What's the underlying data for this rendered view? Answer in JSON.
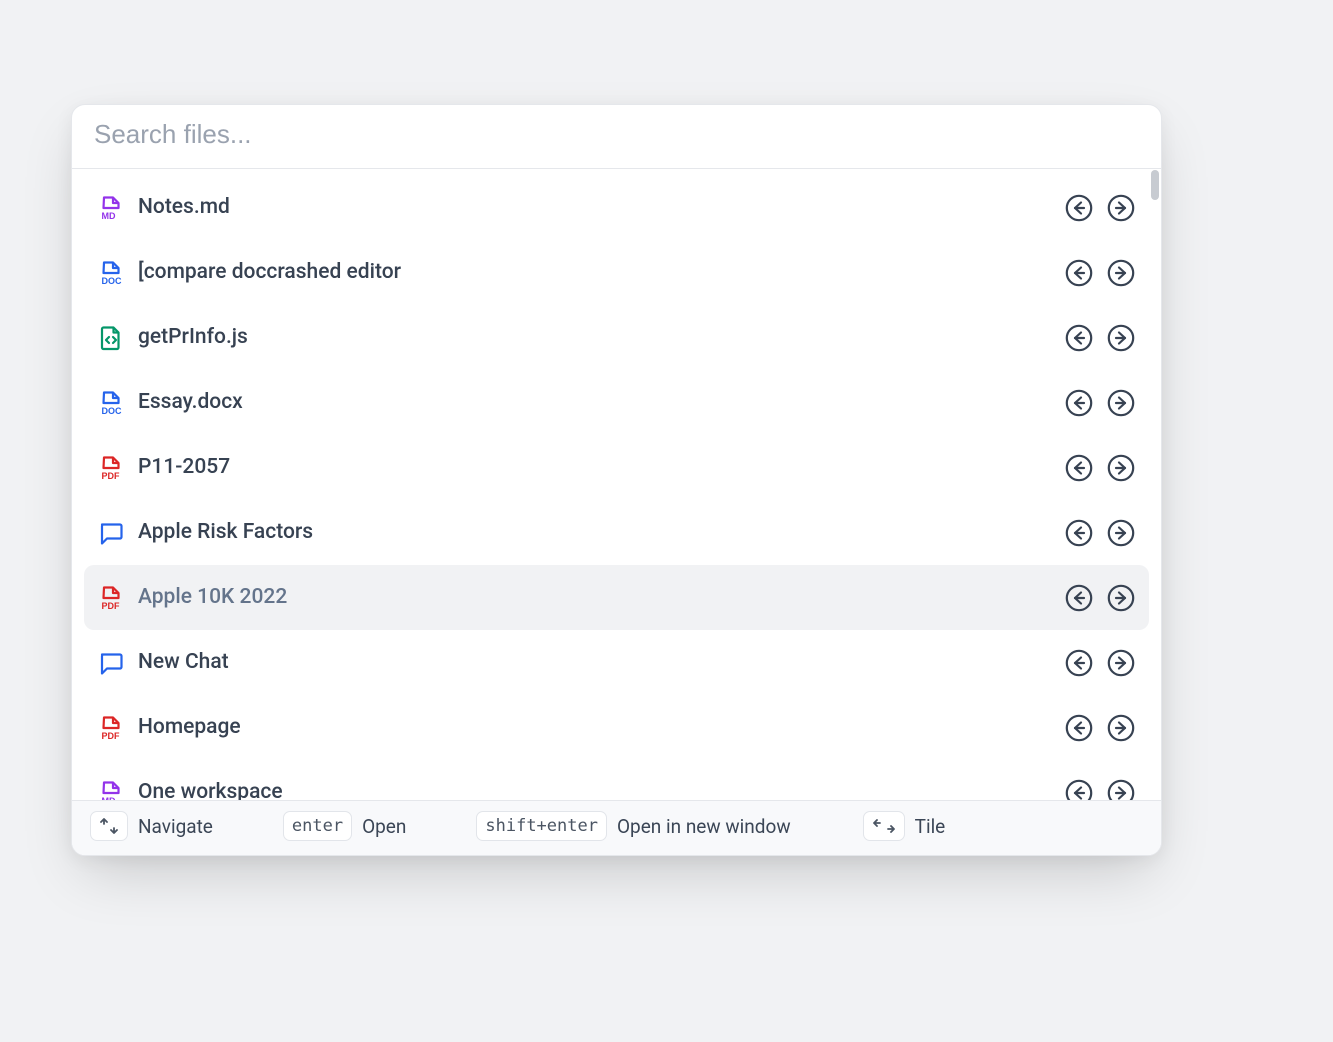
{
  "search": {
    "placeholder": "Search files...",
    "value": ""
  },
  "selected_index": 6,
  "files": [
    {
      "label": "Notes.md",
      "icon": "md",
      "icon_name": "markdown-file-icon"
    },
    {
      "label": "[compare doccrashed editor",
      "icon": "doc",
      "icon_name": "doc-file-icon"
    },
    {
      "label": "getPrInfo.js",
      "icon": "code",
      "icon_name": "code-file-icon"
    },
    {
      "label": "Essay.docx",
      "icon": "doc",
      "icon_name": "doc-file-icon"
    },
    {
      "label": "P11-2057",
      "icon": "pdf",
      "icon_name": "pdf-file-icon"
    },
    {
      "label": "Apple Risk Factors",
      "icon": "chat",
      "icon_name": "chat-icon"
    },
    {
      "label": "Apple 10K 2022",
      "icon": "pdf",
      "icon_name": "pdf-file-icon"
    },
    {
      "label": "New Chat",
      "icon": "chat",
      "icon_name": "chat-icon"
    },
    {
      "label": "Homepage",
      "icon": "pdf",
      "icon_name": "pdf-file-icon"
    },
    {
      "label": "One workspace",
      "icon": "md",
      "icon_name": "markdown-file-icon"
    }
  ],
  "footer": {
    "hints": [
      {
        "key": "updown",
        "label": "Navigate"
      },
      {
        "key": "enter",
        "label": "Open"
      },
      {
        "key": "shift+enter",
        "label": "Open in new window"
      },
      {
        "key": "leftright",
        "label": "Tile"
      }
    ]
  },
  "colors": {
    "md": "#9333ea",
    "doc": "#2563eb",
    "code": "#059669",
    "pdf": "#dc2626",
    "chat": "#2563eb",
    "arrow_stroke": "#374252"
  }
}
